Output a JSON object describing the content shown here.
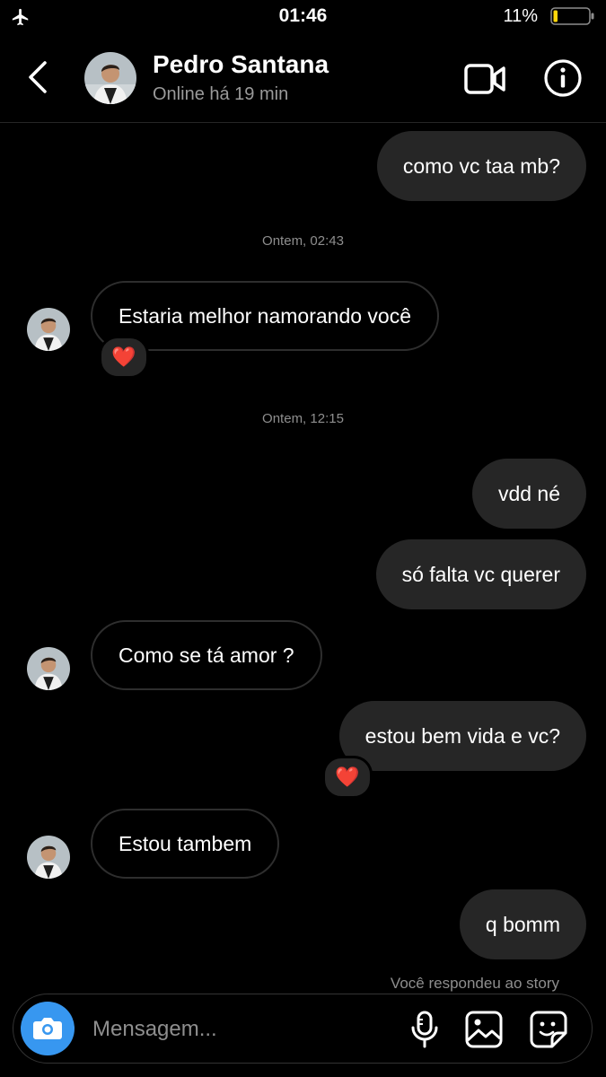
{
  "status_bar": {
    "time": "01:46",
    "battery": "11%",
    "icons": [
      "airplane-icon",
      "battery-icon"
    ]
  },
  "header": {
    "name": "Pedro Santana",
    "status": "Online há 19 min",
    "icons": [
      "back-chevron-icon",
      "video-call-icon",
      "info-icon"
    ]
  },
  "messages": [
    {
      "from": "me",
      "text": "como vc taa mb?"
    },
    {
      "type": "timestamp",
      "text": "Ontem, 02:43"
    },
    {
      "from": "them",
      "text": "Estaria melhor namorando você",
      "reaction": "❤️"
    },
    {
      "type": "timestamp",
      "text": "Ontem, 12:15"
    },
    {
      "from": "me",
      "text": "vdd né"
    },
    {
      "from": "me",
      "text": "só falta vc querer"
    },
    {
      "from": "them",
      "text": "Como se tá amor ?"
    },
    {
      "from": "me",
      "text": "estou bem vida e vc?",
      "reaction": "❤️"
    },
    {
      "from": "them",
      "text": "Estou tambem"
    },
    {
      "from": "me",
      "text": "q bomm"
    }
  ],
  "story_note": "Você respondeu ao story",
  "composer": {
    "placeholder": "Mensagem...",
    "icons": [
      "camera-icon",
      "microphone-icon",
      "gallery-icon",
      "sticker-icon"
    ]
  },
  "colors": {
    "background": "#000000",
    "outgoing_bubble": "#262626",
    "camera_button": "#3797f0"
  }
}
